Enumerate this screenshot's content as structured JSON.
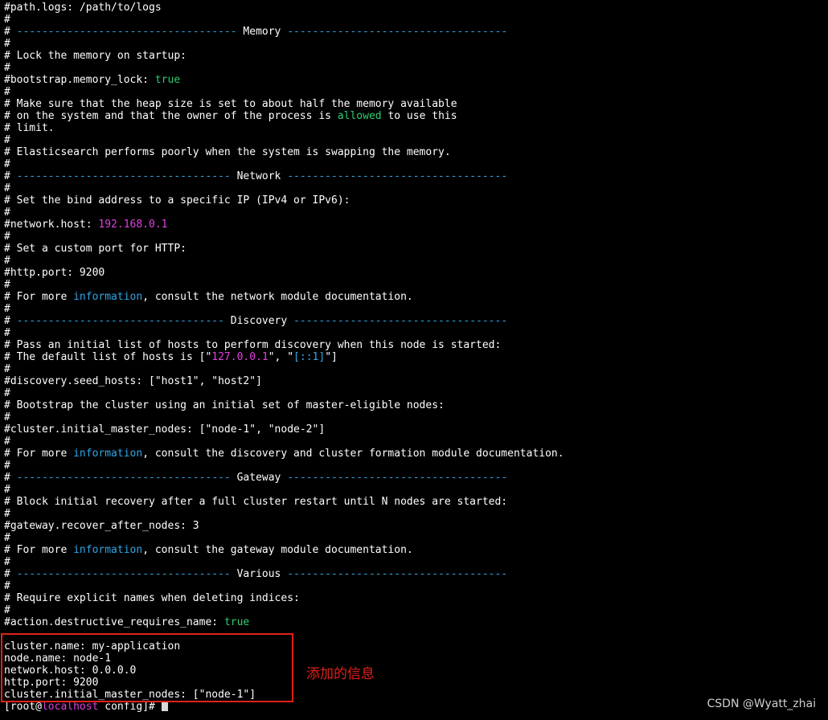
{
  "terminal": {
    "lines": [
      [
        {
          "t": "#path.logs: /path/to/logs",
          "c": "white"
        }
      ],
      [
        {
          "t": "#",
          "c": "white"
        }
      ],
      [
        {
          "t": "# ",
          "c": "white"
        },
        {
          "t": "----------------------------------- ",
          "c": "dash"
        },
        {
          "t": "Memory",
          "c": "white"
        },
        {
          "t": " -----------------------------------",
          "c": "dash"
        }
      ],
      [
        {
          "t": "#",
          "c": "white"
        }
      ],
      [
        {
          "t": "# Lock the memory on startup:",
          "c": "white"
        }
      ],
      [
        {
          "t": "#",
          "c": "white"
        }
      ],
      [
        {
          "t": "#bootstrap.memory_lock: ",
          "c": "white"
        },
        {
          "t": "true",
          "c": "green"
        }
      ],
      [
        {
          "t": "#",
          "c": "white"
        }
      ],
      [
        {
          "t": "# Make sure that the heap size is set to about half the memory available",
          "c": "white"
        }
      ],
      [
        {
          "t": "# on the system and that the owner of the process is ",
          "c": "white"
        },
        {
          "t": "allowed",
          "c": "green"
        },
        {
          "t": " to use this",
          "c": "white"
        }
      ],
      [
        {
          "t": "# limit.",
          "c": "white"
        }
      ],
      [
        {
          "t": "#",
          "c": "white"
        }
      ],
      [
        {
          "t": "# Elasticsearch performs poorly when the system is swapping the memory.",
          "c": "white"
        }
      ],
      [
        {
          "t": "#",
          "c": "white"
        }
      ],
      [
        {
          "t": "# ",
          "c": "white"
        },
        {
          "t": "---------------------------------- ",
          "c": "dash"
        },
        {
          "t": "Network",
          "c": "white"
        },
        {
          "t": " -----------------------------------",
          "c": "dash"
        }
      ],
      [
        {
          "t": "#",
          "c": "white"
        }
      ],
      [
        {
          "t": "# Set the bind address to a specific IP (IPv4 or IPv6):",
          "c": "white"
        }
      ],
      [
        {
          "t": "#",
          "c": "white"
        }
      ],
      [
        {
          "t": "#network.host: ",
          "c": "white"
        },
        {
          "t": "192.168.0.1",
          "c": "magenta"
        }
      ],
      [
        {
          "t": "#",
          "c": "white"
        }
      ],
      [
        {
          "t": "# Set a custom port for HTTP:",
          "c": "white"
        }
      ],
      [
        {
          "t": "#",
          "c": "white"
        }
      ],
      [
        {
          "t": "#http.port: 9200",
          "c": "white"
        }
      ],
      [
        {
          "t": "#",
          "c": "white"
        }
      ],
      [
        {
          "t": "# For more ",
          "c": "white"
        },
        {
          "t": "information",
          "c": "cyan"
        },
        {
          "t": ", consult the network module documentation.",
          "c": "white"
        }
      ],
      [
        {
          "t": "#",
          "c": "white"
        }
      ],
      [
        {
          "t": "# ",
          "c": "white"
        },
        {
          "t": "--------------------------------- ",
          "c": "dash"
        },
        {
          "t": "Discovery",
          "c": "white"
        },
        {
          "t": " ----------------------------------",
          "c": "dash"
        }
      ],
      [
        {
          "t": "#",
          "c": "white"
        }
      ],
      [
        {
          "t": "# Pass an initial list of hosts to perform discovery when this node is started:",
          "c": "white"
        }
      ],
      [
        {
          "t": "# The default list of hosts is [\"",
          "c": "white"
        },
        {
          "t": "127.0.0.1",
          "c": "magenta"
        },
        {
          "t": "\", \"",
          "c": "white"
        },
        {
          "t": "[::1]",
          "c": "cyan"
        },
        {
          "t": "\"]",
          "c": "white"
        }
      ],
      [
        {
          "t": "#",
          "c": "white"
        }
      ],
      [
        {
          "t": "#discovery.seed_hosts: [\"host1\", \"host2\"]",
          "c": "white"
        }
      ],
      [
        {
          "t": "#",
          "c": "white"
        }
      ],
      [
        {
          "t": "# Bootstrap the cluster using an initial set of master-eligible nodes:",
          "c": "white"
        }
      ],
      [
        {
          "t": "#",
          "c": "white"
        }
      ],
      [
        {
          "t": "#cluster.initial_master_nodes: [\"node-1\", \"node-2\"]",
          "c": "white"
        }
      ],
      [
        {
          "t": "#",
          "c": "white"
        }
      ],
      [
        {
          "t": "# For more ",
          "c": "white"
        },
        {
          "t": "information",
          "c": "cyan"
        },
        {
          "t": ", consult the discovery and cluster formation module documentation.",
          "c": "white"
        }
      ],
      [
        {
          "t": "#",
          "c": "white"
        }
      ],
      [
        {
          "t": "# ",
          "c": "white"
        },
        {
          "t": "---------------------------------- ",
          "c": "dash"
        },
        {
          "t": "Gateway",
          "c": "white"
        },
        {
          "t": " -----------------------------------",
          "c": "dash"
        }
      ],
      [
        {
          "t": "#",
          "c": "white"
        }
      ],
      [
        {
          "t": "# Block initial recovery after a full cluster restart until N nodes are started:",
          "c": "white"
        }
      ],
      [
        {
          "t": "#",
          "c": "white"
        }
      ],
      [
        {
          "t": "#gateway.recover_after_nodes: 3",
          "c": "white"
        }
      ],
      [
        {
          "t": "#",
          "c": "white"
        }
      ],
      [
        {
          "t": "# For more ",
          "c": "white"
        },
        {
          "t": "information",
          "c": "cyan"
        },
        {
          "t": ", consult the gateway module documentation.",
          "c": "white"
        }
      ],
      [
        {
          "t": "#",
          "c": "white"
        }
      ],
      [
        {
          "t": "# ",
          "c": "white"
        },
        {
          "t": "---------------------------------- ",
          "c": "dash"
        },
        {
          "t": "Various",
          "c": "white"
        },
        {
          "t": " -----------------------------------",
          "c": "dash"
        }
      ],
      [
        {
          "t": "#",
          "c": "white"
        }
      ],
      [
        {
          "t": "# Require explicit names when deleting indices:",
          "c": "white"
        }
      ],
      [
        {
          "t": "#",
          "c": "white"
        }
      ],
      [
        {
          "t": "#action.destructive_requires_name: ",
          "c": "white"
        },
        {
          "t": "true",
          "c": "green"
        }
      ],
      [],
      [
        {
          "t": "cluster.name: my-application",
          "c": "white"
        }
      ],
      [
        {
          "t": "node.name: node-1",
          "c": "white"
        }
      ],
      [
        {
          "t": "network.host: 0.0.0.0",
          "c": "white"
        }
      ],
      [
        {
          "t": "http.port: 9200",
          "c": "white"
        }
      ],
      [
        {
          "t": "cluster.initial_master_nodes: [\"node-1\"]",
          "c": "white"
        }
      ]
    ],
    "prompt": [
      {
        "t": "[root@",
        "c": "white"
      },
      {
        "t": "localhost",
        "c": "magenta"
      },
      {
        "t": " config]# ",
        "c": "white"
      }
    ]
  },
  "annotation": {
    "text": "添加的信息"
  },
  "watermark": {
    "text": "CSDN @Wyatt_zhai"
  },
  "colors": {
    "background": "#000000",
    "text": "#ffffff",
    "keyword_green": "#2ecc71",
    "number_magenta": "#e040e0",
    "link_cyan": "#31a6e6",
    "highlight_red": "#e0201a"
  }
}
